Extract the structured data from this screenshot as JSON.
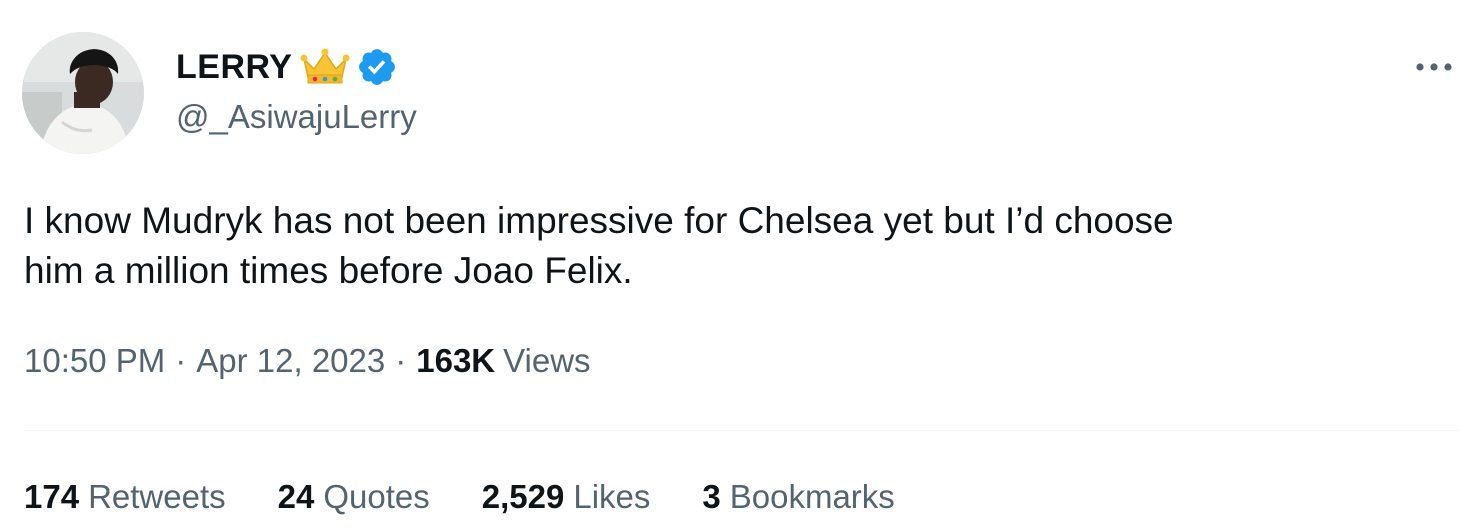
{
  "author": {
    "display_name": "LERRY",
    "handle": "@_AsiwajuLerry",
    "icons": [
      "crown-emoji",
      "verified-badge-icon"
    ],
    "verified_color": "#1d9bf0"
  },
  "tweet": {
    "text": "I know Mudryk has not been impressive for Chelsea yet but I’d choose\nhim a million times before Joao Felix."
  },
  "meta": {
    "time": "10:50 PM",
    "separator": "·",
    "date": "Apr 12, 2023",
    "views_count": "163K",
    "views_label": "Views"
  },
  "stats": [
    {
      "count": "174",
      "label": "Retweets"
    },
    {
      "count": "24",
      "label": "Quotes"
    },
    {
      "count": "2,529",
      "label": "Likes"
    },
    {
      "count": "3",
      "label": "Bookmarks"
    }
  ],
  "more_icon": "more-horizontal-icon"
}
